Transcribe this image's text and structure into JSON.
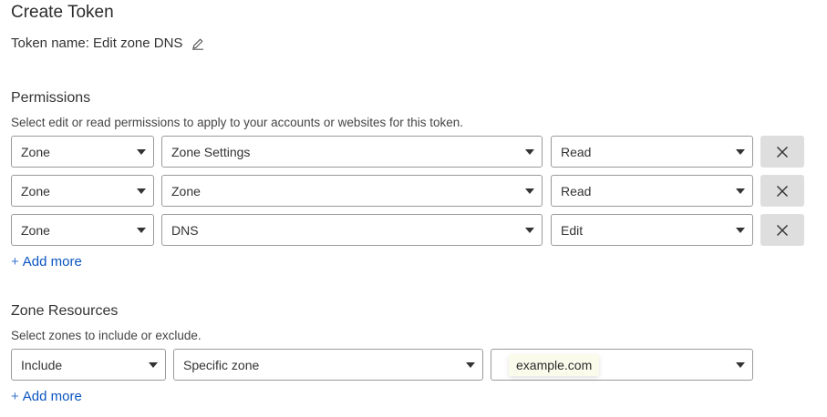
{
  "page": {
    "title": "Create Token",
    "token_name": "Token name: Edit zone DNS"
  },
  "permissions": {
    "heading": "Permissions",
    "description": "Select edit or read permissions to apply to your accounts or websites for this token.",
    "rows": [
      {
        "scope": "Zone",
        "resource": "Zone Settings",
        "access": "Read"
      },
      {
        "scope": "Zone",
        "resource": "Zone",
        "access": "Read"
      },
      {
        "scope": "Zone",
        "resource": "DNS",
        "access": "Edit"
      }
    ],
    "add_more": "Add more"
  },
  "zone_resources": {
    "heading": "Zone Resources",
    "description": "Select zones to include or exclude.",
    "mode": "Include",
    "type": "Specific zone",
    "zone": "example.com",
    "add_more": "Add more"
  },
  "colors": {
    "link": "#0a55c0",
    "delete_button_bg": "#dedede",
    "chip_bg": "#fbfbec"
  },
  "icons": {
    "edit": "pencil-icon",
    "remove": "close-icon",
    "dropdown": "chevron-down-icon",
    "add": "plus-icon"
  }
}
